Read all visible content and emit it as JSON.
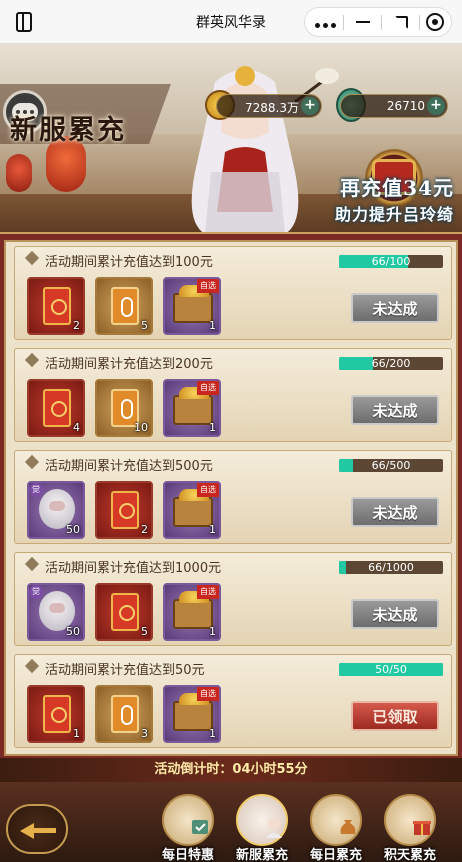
{
  "window": {
    "title": "群英风华录"
  },
  "currency": {
    "gold": "7288.3万",
    "jade": "26710"
  },
  "banner": {
    "title": "新服累充",
    "recharge_line1": "再充值34元",
    "recharge_line2": "助力提升吕玲绮"
  },
  "tasks": [
    {
      "title": "活动期间累计充值达到100元",
      "progress_text": "66/100",
      "progress": 0.66,
      "status": "未达成",
      "claimed": false,
      "rewards": [
        {
          "type": "red-envelope",
          "count": "2"
        },
        {
          "type": "gold-scroll",
          "count": "5"
        },
        {
          "type": "choice-chest",
          "tag": "自选",
          "count": "1"
        }
      ]
    },
    {
      "title": "活动期间累计充值达到200元",
      "progress_text": "66/200",
      "progress": 0.33,
      "status": "未达成",
      "claimed": false,
      "rewards": [
        {
          "type": "red-envelope",
          "count": "4"
        },
        {
          "type": "gold-scroll",
          "count": "10"
        },
        {
          "type": "choice-chest",
          "tag": "自选",
          "count": "1"
        }
      ]
    },
    {
      "title": "活动期间累计充值达到500元",
      "progress_text": "66/500",
      "progress": 0.132,
      "status": "未达成",
      "claimed": false,
      "rewards": [
        {
          "type": "hero-chip",
          "tag": "觉",
          "count": "50"
        },
        {
          "type": "red-envelope",
          "count": "2"
        },
        {
          "type": "choice-chest",
          "tag": "自选",
          "count": "1"
        }
      ]
    },
    {
      "title": "活动期间累计充值达到1000元",
      "progress_text": "66/1000",
      "progress": 0.066,
      "status": "未达成",
      "claimed": false,
      "rewards": [
        {
          "type": "hero-chip",
          "tag": "觉",
          "count": "50"
        },
        {
          "type": "red-envelope",
          "count": "5"
        },
        {
          "type": "choice-chest",
          "tag": "自选",
          "count": "1"
        }
      ]
    },
    {
      "title": "活动期间累计充值达到50元",
      "progress_text": "50/50",
      "progress": 1.0,
      "status": "已领取",
      "claimed": true,
      "rewards": [
        {
          "type": "red-envelope",
          "count": "1"
        },
        {
          "type": "gold-scroll",
          "count": "3"
        },
        {
          "type": "choice-chest",
          "tag": "自选",
          "count": "1"
        }
      ]
    }
  ],
  "countdown": "活动倒计时：04小时55分",
  "tabs": [
    {
      "label": "每日特惠",
      "active": false
    },
    {
      "label": "新服累充",
      "active": true
    },
    {
      "label": "每日累充",
      "active": false
    },
    {
      "label": "积天累充",
      "active": false
    }
  ],
  "colors": {
    "progress_fill": "#20c9a2",
    "panel_bg": "#7a2a22",
    "claimed_btn": "#b83a2e"
  }
}
